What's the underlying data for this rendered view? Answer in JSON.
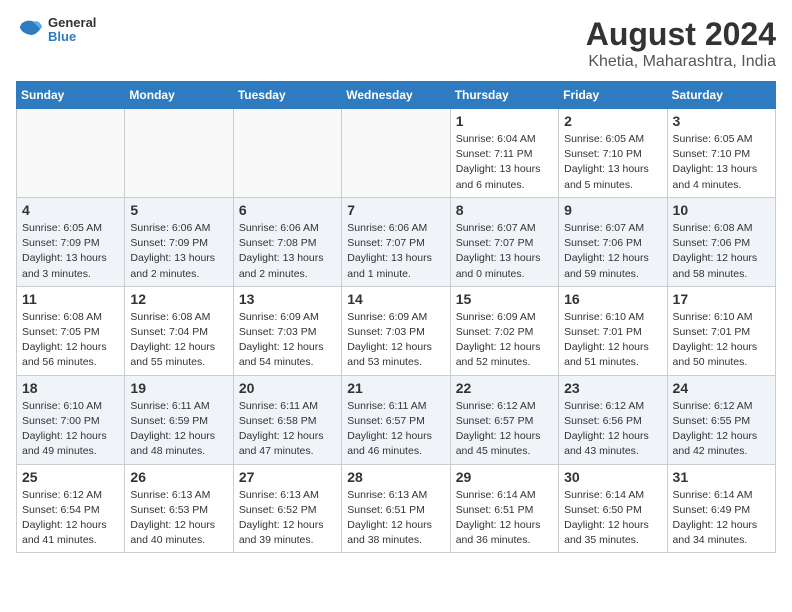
{
  "header": {
    "logo": {
      "line1": "General",
      "line2": "Blue"
    },
    "title": "August 2024",
    "subtitle": "Khetia, Maharashtra, India"
  },
  "weekdays": [
    "Sunday",
    "Monday",
    "Tuesday",
    "Wednesday",
    "Thursday",
    "Friday",
    "Saturday"
  ],
  "weeks": [
    [
      {
        "day": "",
        "info": ""
      },
      {
        "day": "",
        "info": ""
      },
      {
        "day": "",
        "info": ""
      },
      {
        "day": "",
        "info": ""
      },
      {
        "day": "1",
        "info": "Sunrise: 6:04 AM\nSunset: 7:11 PM\nDaylight: 13 hours\nand 6 minutes."
      },
      {
        "day": "2",
        "info": "Sunrise: 6:05 AM\nSunset: 7:10 PM\nDaylight: 13 hours\nand 5 minutes."
      },
      {
        "day": "3",
        "info": "Sunrise: 6:05 AM\nSunset: 7:10 PM\nDaylight: 13 hours\nand 4 minutes."
      }
    ],
    [
      {
        "day": "4",
        "info": "Sunrise: 6:05 AM\nSunset: 7:09 PM\nDaylight: 13 hours\nand 3 minutes."
      },
      {
        "day": "5",
        "info": "Sunrise: 6:06 AM\nSunset: 7:09 PM\nDaylight: 13 hours\nand 2 minutes."
      },
      {
        "day": "6",
        "info": "Sunrise: 6:06 AM\nSunset: 7:08 PM\nDaylight: 13 hours\nand 2 minutes."
      },
      {
        "day": "7",
        "info": "Sunrise: 6:06 AM\nSunset: 7:07 PM\nDaylight: 13 hours\nand 1 minute."
      },
      {
        "day": "8",
        "info": "Sunrise: 6:07 AM\nSunset: 7:07 PM\nDaylight: 13 hours\nand 0 minutes."
      },
      {
        "day": "9",
        "info": "Sunrise: 6:07 AM\nSunset: 7:06 PM\nDaylight: 12 hours\nand 59 minutes."
      },
      {
        "day": "10",
        "info": "Sunrise: 6:08 AM\nSunset: 7:06 PM\nDaylight: 12 hours\nand 58 minutes."
      }
    ],
    [
      {
        "day": "11",
        "info": "Sunrise: 6:08 AM\nSunset: 7:05 PM\nDaylight: 12 hours\nand 56 minutes."
      },
      {
        "day": "12",
        "info": "Sunrise: 6:08 AM\nSunset: 7:04 PM\nDaylight: 12 hours\nand 55 minutes."
      },
      {
        "day": "13",
        "info": "Sunrise: 6:09 AM\nSunset: 7:03 PM\nDaylight: 12 hours\nand 54 minutes."
      },
      {
        "day": "14",
        "info": "Sunrise: 6:09 AM\nSunset: 7:03 PM\nDaylight: 12 hours\nand 53 minutes."
      },
      {
        "day": "15",
        "info": "Sunrise: 6:09 AM\nSunset: 7:02 PM\nDaylight: 12 hours\nand 52 minutes."
      },
      {
        "day": "16",
        "info": "Sunrise: 6:10 AM\nSunset: 7:01 PM\nDaylight: 12 hours\nand 51 minutes."
      },
      {
        "day": "17",
        "info": "Sunrise: 6:10 AM\nSunset: 7:01 PM\nDaylight: 12 hours\nand 50 minutes."
      }
    ],
    [
      {
        "day": "18",
        "info": "Sunrise: 6:10 AM\nSunset: 7:00 PM\nDaylight: 12 hours\nand 49 minutes."
      },
      {
        "day": "19",
        "info": "Sunrise: 6:11 AM\nSunset: 6:59 PM\nDaylight: 12 hours\nand 48 minutes."
      },
      {
        "day": "20",
        "info": "Sunrise: 6:11 AM\nSunset: 6:58 PM\nDaylight: 12 hours\nand 47 minutes."
      },
      {
        "day": "21",
        "info": "Sunrise: 6:11 AM\nSunset: 6:57 PM\nDaylight: 12 hours\nand 46 minutes."
      },
      {
        "day": "22",
        "info": "Sunrise: 6:12 AM\nSunset: 6:57 PM\nDaylight: 12 hours\nand 45 minutes."
      },
      {
        "day": "23",
        "info": "Sunrise: 6:12 AM\nSunset: 6:56 PM\nDaylight: 12 hours\nand 43 minutes."
      },
      {
        "day": "24",
        "info": "Sunrise: 6:12 AM\nSunset: 6:55 PM\nDaylight: 12 hours\nand 42 minutes."
      }
    ],
    [
      {
        "day": "25",
        "info": "Sunrise: 6:12 AM\nSunset: 6:54 PM\nDaylight: 12 hours\nand 41 minutes."
      },
      {
        "day": "26",
        "info": "Sunrise: 6:13 AM\nSunset: 6:53 PM\nDaylight: 12 hours\nand 40 minutes."
      },
      {
        "day": "27",
        "info": "Sunrise: 6:13 AM\nSunset: 6:52 PM\nDaylight: 12 hours\nand 39 minutes."
      },
      {
        "day": "28",
        "info": "Sunrise: 6:13 AM\nSunset: 6:51 PM\nDaylight: 12 hours\nand 38 minutes."
      },
      {
        "day": "29",
        "info": "Sunrise: 6:14 AM\nSunset: 6:51 PM\nDaylight: 12 hours\nand 36 minutes."
      },
      {
        "day": "30",
        "info": "Sunrise: 6:14 AM\nSunset: 6:50 PM\nDaylight: 12 hours\nand 35 minutes."
      },
      {
        "day": "31",
        "info": "Sunrise: 6:14 AM\nSunset: 6:49 PM\nDaylight: 12 hours\nand 34 minutes."
      }
    ]
  ]
}
